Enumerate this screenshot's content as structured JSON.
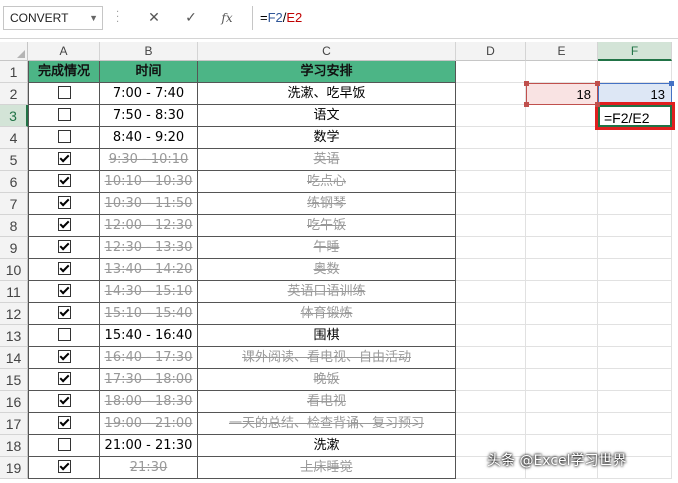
{
  "name_box": "CONVERT",
  "formula_icons": {
    "cancel": "✕",
    "enter": "✓",
    "function": "fx"
  },
  "formula": {
    "eq": "=",
    "ref1": "F2",
    "op": "/",
    "ref2": "E2"
  },
  "columns": [
    "A",
    "B",
    "C",
    "D",
    "E",
    "F"
  ],
  "rows": [
    "1",
    "2",
    "3",
    "4",
    "5",
    "6",
    "7",
    "8",
    "9",
    "10",
    "11",
    "12",
    "13",
    "14",
    "15",
    "16",
    "17",
    "18",
    "19"
  ],
  "selected_cell": {
    "column": "F",
    "row": "3"
  },
  "table": {
    "headers": {
      "status": "完成情况",
      "time": "时间",
      "plan": "学习安排"
    },
    "items": [
      {
        "checked": false,
        "time": "7:00 - 7:40",
        "task": "洗漱、吃早饭"
      },
      {
        "checked": false,
        "time": "7:50 - 8:30",
        "task": "语文"
      },
      {
        "checked": false,
        "time": "8:40 - 9:20",
        "task": "数学"
      },
      {
        "checked": true,
        "time": "9:30 - 10:10",
        "task": "英语"
      },
      {
        "checked": true,
        "time": "10:10 - 10:30",
        "task": "吃点心"
      },
      {
        "checked": true,
        "time": "10:30 - 11:50",
        "task": "练钢琴"
      },
      {
        "checked": true,
        "time": "12:00 - 12:30",
        "task": "吃午饭"
      },
      {
        "checked": true,
        "time": "12:30 - 13:30",
        "task": "午睡"
      },
      {
        "checked": true,
        "time": "13:40 - 14:20",
        "task": "奥数"
      },
      {
        "checked": true,
        "time": "14:30 - 15:10",
        "task": "英语口语训练"
      },
      {
        "checked": true,
        "time": "15:10 - 15:40",
        "task": "体育锻炼"
      },
      {
        "checked": false,
        "time": "15:40 - 16:40",
        "task": "围棋"
      },
      {
        "checked": true,
        "time": "16:40 - 17:30",
        "task": "课外阅读、看电视、自由活动"
      },
      {
        "checked": true,
        "time": "17:30 - 18:00",
        "task": "晚饭"
      },
      {
        "checked": true,
        "time": "18:00 - 18:30",
        "task": "看电视"
      },
      {
        "checked": true,
        "time": "19:00 - 21:00",
        "task": "一天的总结、检查背诵、复习预习"
      },
      {
        "checked": false,
        "time": "21:00 - 21:30",
        "task": "洗漱"
      },
      {
        "checked": true,
        "time": "21:30",
        "task": "上床睡觉"
      }
    ]
  },
  "cells": {
    "E2": "18",
    "F2": "13",
    "F3": "=F2/E2"
  },
  "colors": {
    "header_green": "#4cb586",
    "ref_red": "#c00000",
    "ref_blue": "#2f5597",
    "active_green": "#217346",
    "highlight_red": "#e02020"
  },
  "watermark": "头条 @Excel学习世界"
}
